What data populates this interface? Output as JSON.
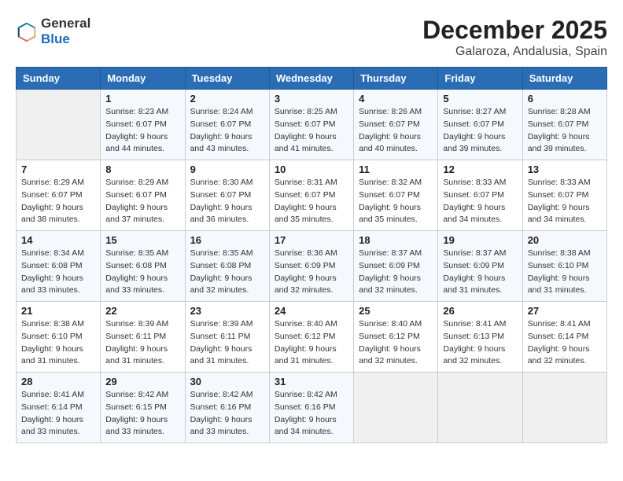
{
  "header": {
    "logo": {
      "text_general": "General",
      "text_blue": "Blue"
    },
    "month": "December 2025",
    "location": "Galaroza, Andalusia, Spain"
  },
  "weekdays": [
    "Sunday",
    "Monday",
    "Tuesday",
    "Wednesday",
    "Thursday",
    "Friday",
    "Saturday"
  ],
  "weeks": [
    [
      {
        "day": "",
        "empty": true
      },
      {
        "day": "1",
        "sunrise": "8:23 AM",
        "sunset": "6:07 PM",
        "daylight": "9 hours and 44 minutes."
      },
      {
        "day": "2",
        "sunrise": "8:24 AM",
        "sunset": "6:07 PM",
        "daylight": "9 hours and 43 minutes."
      },
      {
        "day": "3",
        "sunrise": "8:25 AM",
        "sunset": "6:07 PM",
        "daylight": "9 hours and 41 minutes."
      },
      {
        "day": "4",
        "sunrise": "8:26 AM",
        "sunset": "6:07 PM",
        "daylight": "9 hours and 40 minutes."
      },
      {
        "day": "5",
        "sunrise": "8:27 AM",
        "sunset": "6:07 PM",
        "daylight": "9 hours and 39 minutes."
      },
      {
        "day": "6",
        "sunrise": "8:28 AM",
        "sunset": "6:07 PM",
        "daylight": "9 hours and 39 minutes."
      }
    ],
    [
      {
        "day": "7",
        "sunrise": "8:29 AM",
        "sunset": "6:07 PM",
        "daylight": "9 hours and 38 minutes."
      },
      {
        "day": "8",
        "sunrise": "8:29 AM",
        "sunset": "6:07 PM",
        "daylight": "9 hours and 37 minutes."
      },
      {
        "day": "9",
        "sunrise": "8:30 AM",
        "sunset": "6:07 PM",
        "daylight": "9 hours and 36 minutes."
      },
      {
        "day": "10",
        "sunrise": "8:31 AM",
        "sunset": "6:07 PM",
        "daylight": "9 hours and 35 minutes."
      },
      {
        "day": "11",
        "sunrise": "8:32 AM",
        "sunset": "6:07 PM",
        "daylight": "9 hours and 35 minutes."
      },
      {
        "day": "12",
        "sunrise": "8:33 AM",
        "sunset": "6:07 PM",
        "daylight": "9 hours and 34 minutes."
      },
      {
        "day": "13",
        "sunrise": "8:33 AM",
        "sunset": "6:07 PM",
        "daylight": "9 hours and 34 minutes."
      }
    ],
    [
      {
        "day": "14",
        "sunrise": "8:34 AM",
        "sunset": "6:08 PM",
        "daylight": "9 hours and 33 minutes."
      },
      {
        "day": "15",
        "sunrise": "8:35 AM",
        "sunset": "6:08 PM",
        "daylight": "9 hours and 33 minutes."
      },
      {
        "day": "16",
        "sunrise": "8:35 AM",
        "sunset": "6:08 PM",
        "daylight": "9 hours and 32 minutes."
      },
      {
        "day": "17",
        "sunrise": "8:36 AM",
        "sunset": "6:09 PM",
        "daylight": "9 hours and 32 minutes."
      },
      {
        "day": "18",
        "sunrise": "8:37 AM",
        "sunset": "6:09 PM",
        "daylight": "9 hours and 32 minutes."
      },
      {
        "day": "19",
        "sunrise": "8:37 AM",
        "sunset": "6:09 PM",
        "daylight": "9 hours and 31 minutes."
      },
      {
        "day": "20",
        "sunrise": "8:38 AM",
        "sunset": "6:10 PM",
        "daylight": "9 hours and 31 minutes."
      }
    ],
    [
      {
        "day": "21",
        "sunrise": "8:38 AM",
        "sunset": "6:10 PM",
        "daylight": "9 hours and 31 minutes."
      },
      {
        "day": "22",
        "sunrise": "8:39 AM",
        "sunset": "6:11 PM",
        "daylight": "9 hours and 31 minutes."
      },
      {
        "day": "23",
        "sunrise": "8:39 AM",
        "sunset": "6:11 PM",
        "daylight": "9 hours and 31 minutes."
      },
      {
        "day": "24",
        "sunrise": "8:40 AM",
        "sunset": "6:12 PM",
        "daylight": "9 hours and 31 minutes."
      },
      {
        "day": "25",
        "sunrise": "8:40 AM",
        "sunset": "6:12 PM",
        "daylight": "9 hours and 32 minutes."
      },
      {
        "day": "26",
        "sunrise": "8:41 AM",
        "sunset": "6:13 PM",
        "daylight": "9 hours and 32 minutes."
      },
      {
        "day": "27",
        "sunrise": "8:41 AM",
        "sunset": "6:14 PM",
        "daylight": "9 hours and 32 minutes."
      }
    ],
    [
      {
        "day": "28",
        "sunrise": "8:41 AM",
        "sunset": "6:14 PM",
        "daylight": "9 hours and 33 minutes."
      },
      {
        "day": "29",
        "sunrise": "8:42 AM",
        "sunset": "6:15 PM",
        "daylight": "9 hours and 33 minutes."
      },
      {
        "day": "30",
        "sunrise": "8:42 AM",
        "sunset": "6:16 PM",
        "daylight": "9 hours and 33 minutes."
      },
      {
        "day": "31",
        "sunrise": "8:42 AM",
        "sunset": "6:16 PM",
        "daylight": "9 hours and 34 minutes."
      },
      {
        "day": "",
        "empty": true
      },
      {
        "day": "",
        "empty": true
      },
      {
        "day": "",
        "empty": true
      }
    ]
  ]
}
